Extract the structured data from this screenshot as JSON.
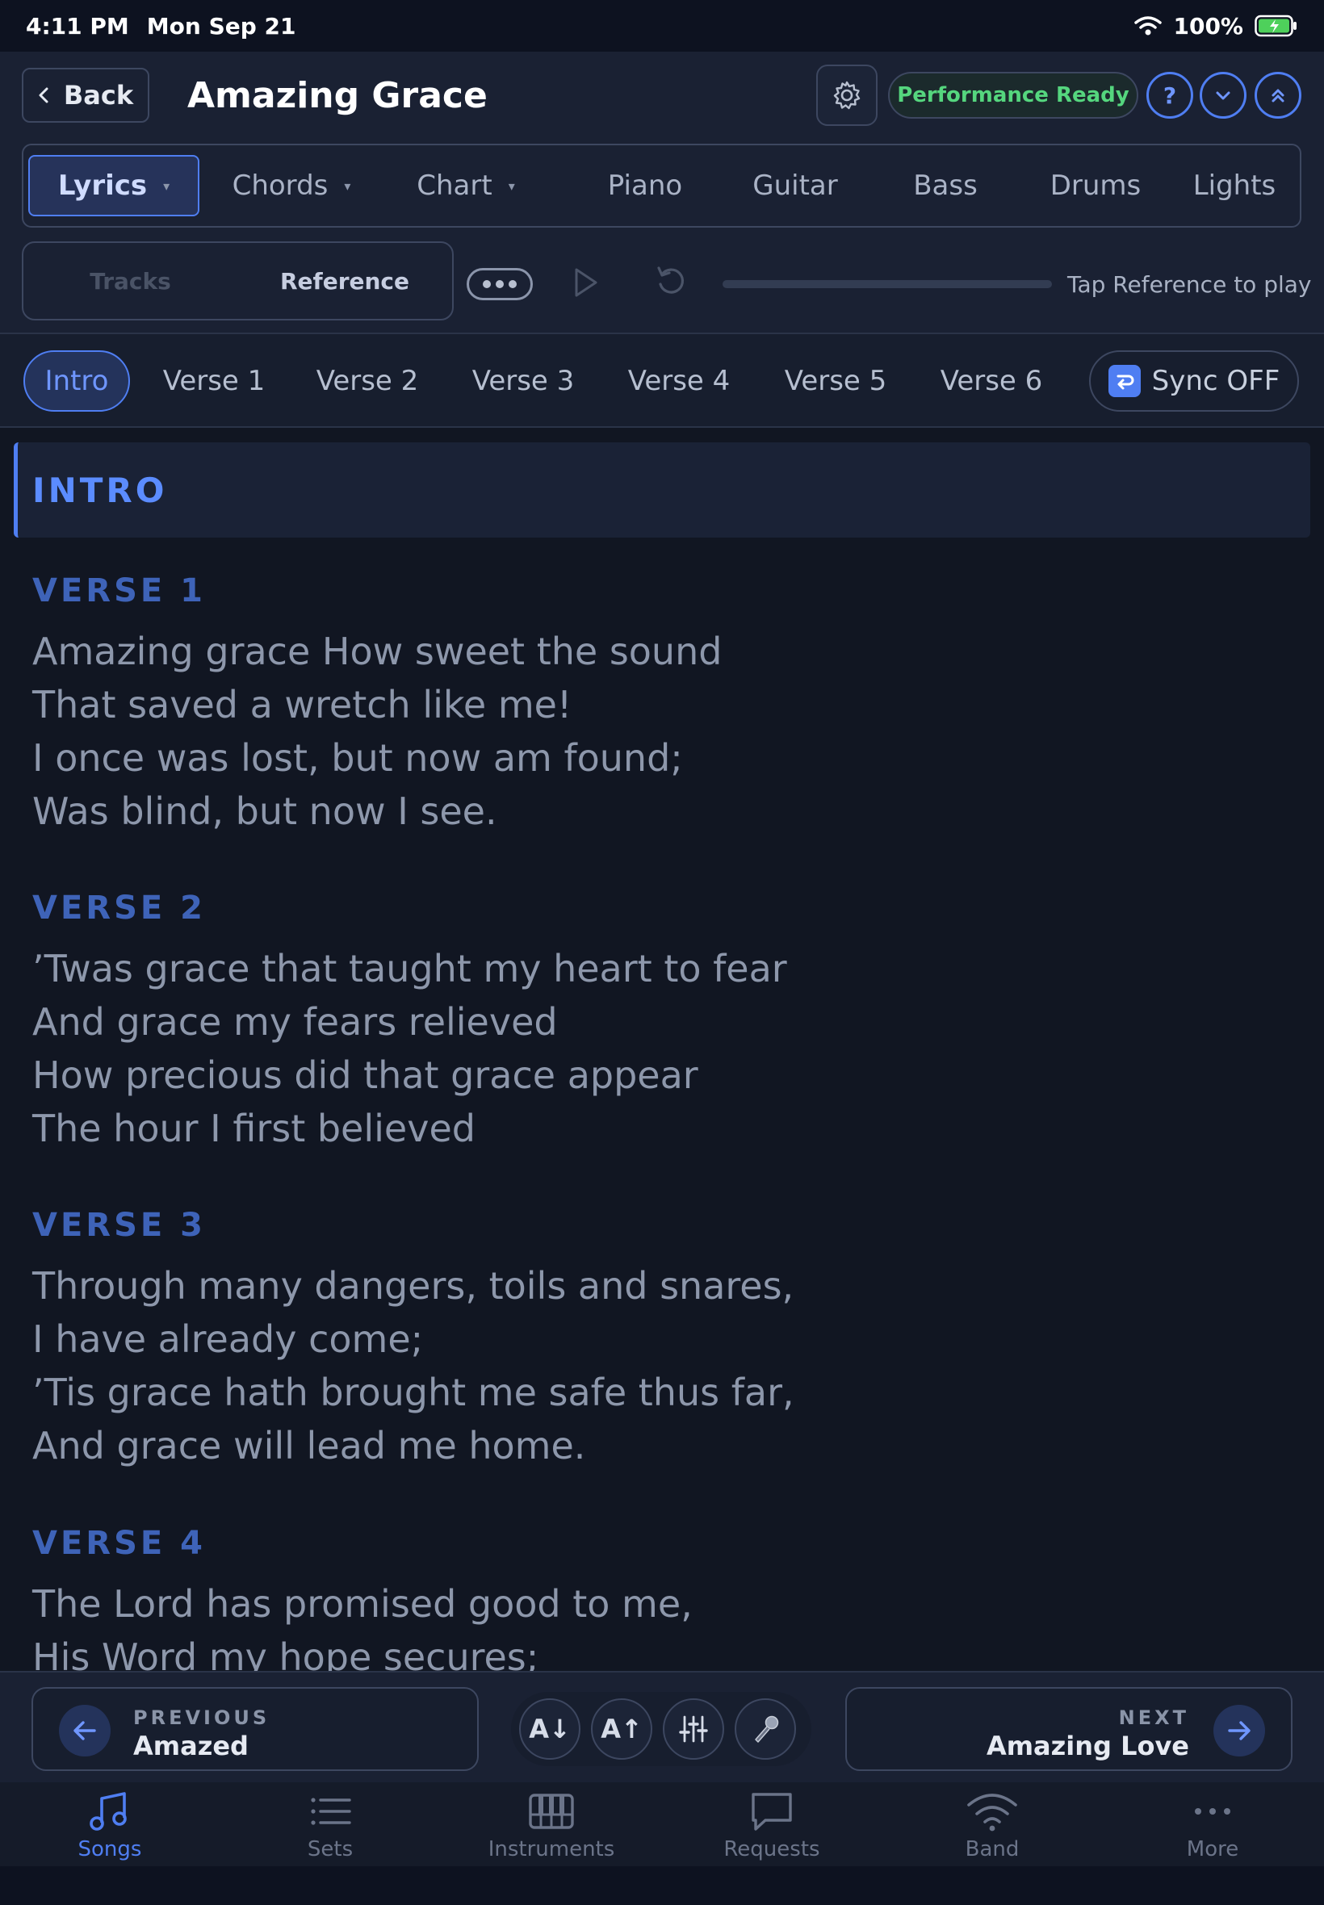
{
  "status": {
    "time": "4:11 PM",
    "date": "Mon Sep 21",
    "battery": "100%"
  },
  "header": {
    "back_label": "Back",
    "title": "Amazing Grace",
    "badge": "Performance Ready",
    "help_label": "?"
  },
  "tabs": [
    {
      "label": "Lyrics"
    },
    {
      "label": "Chords"
    },
    {
      "label": "Chart"
    },
    {
      "label": "Piano"
    },
    {
      "label": "Guitar"
    },
    {
      "label": "Bass"
    },
    {
      "label": "Drums"
    },
    {
      "label": "Lights"
    }
  ],
  "playback": {
    "tracks_label": "Tracks",
    "reference_label": "Reference",
    "hint": "Tap Reference to play"
  },
  "sections": [
    {
      "label": "Intro"
    },
    {
      "label": "Verse 1"
    },
    {
      "label": "Verse 2"
    },
    {
      "label": "Verse 3"
    },
    {
      "label": "Verse 4"
    },
    {
      "label": "Verse 5"
    },
    {
      "label": "Verse 6"
    }
  ],
  "sync_label": "Sync OFF",
  "lyrics": {
    "intro_label": "INTRO",
    "verses": [
      {
        "label": "VERSE 1",
        "lines": [
          "Amazing grace How sweet the sound",
          "That saved a wretch like me!",
          "I once was lost, but now am found;",
          "Was blind, but now I see."
        ]
      },
      {
        "label": "VERSE 2",
        "lines": [
          "’Twas grace that taught my heart to fear",
          "And grace my fears relieved",
          "How precious did that grace appear",
          "The hour I first believed"
        ]
      },
      {
        "label": "VERSE 3",
        "lines": [
          "Through many dangers, toils and snares,",
          "I have already come;",
          "’Tis grace hath brought me safe thus far,",
          "And grace will lead me home."
        ]
      },
      {
        "label": "VERSE 4",
        "lines": [
          "The Lord has promised good to me,",
          "His Word my hope secures;"
        ]
      }
    ]
  },
  "footer_nav": {
    "previous_kicker": "PREVIOUS",
    "previous_song": "Amazed",
    "next_kicker": "NEXT",
    "next_song": "Amazing Love",
    "font_down_label": "A↓",
    "font_up_label": "A↑"
  },
  "tab_bar": [
    {
      "label": "Songs",
      "icon": "music-note-icon"
    },
    {
      "label": "Sets",
      "icon": "list-icon"
    },
    {
      "label": "Instruments",
      "icon": "piano-keys-icon"
    },
    {
      "label": "Requests",
      "icon": "chat-bubble-icon"
    },
    {
      "label": "Band",
      "icon": "wifi-icon"
    },
    {
      "label": "More",
      "icon": "ellipsis-icon"
    }
  ],
  "colors": {
    "accent": "#4f7ef2",
    "ready_green": "#55d67e",
    "background": "#111622"
  }
}
